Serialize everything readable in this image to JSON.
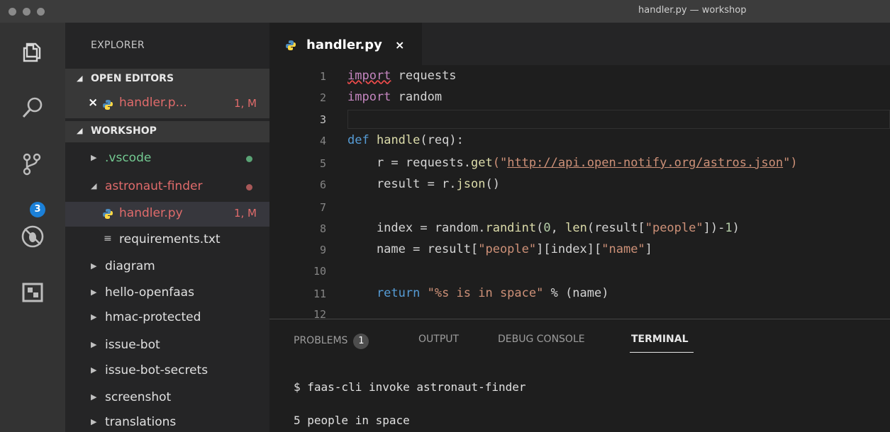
{
  "window": {
    "title": "handler.py — workshop"
  },
  "activity_bar": {
    "icons": [
      "files-icon",
      "search-icon",
      "source-control-icon",
      "debug-icon",
      "extensions-icon"
    ],
    "scm_badge": "3"
  },
  "sidebar": {
    "title": "EXPLORER",
    "open_editors": {
      "header": "OPEN EDITORS",
      "items": [
        {
          "label": "handler.p...",
          "status": "1, M"
        }
      ]
    },
    "workspace": {
      "header": "WORKSHOP",
      "items": [
        {
          "label": ".vscode",
          "type": "folder",
          "expanded": false
        },
        {
          "label": "astronaut-finder",
          "type": "folder",
          "expanded": true
        },
        {
          "label": "handler.py",
          "type": "file",
          "status": "1, M"
        },
        {
          "label": "requirements.txt",
          "type": "file"
        },
        {
          "label": "diagram",
          "type": "folder",
          "expanded": false
        },
        {
          "label": "hello-openfaas",
          "type": "folder",
          "expanded": false
        },
        {
          "label": "hmac-protected",
          "type": "folder",
          "expanded": false
        },
        {
          "label": "issue-bot",
          "type": "folder",
          "expanded": false
        },
        {
          "label": "issue-bot-secrets",
          "type": "folder",
          "expanded": false
        },
        {
          "label": "screenshot",
          "type": "folder",
          "expanded": false
        },
        {
          "label": "translations",
          "type": "folder",
          "expanded": false
        }
      ]
    }
  },
  "editor": {
    "tab": {
      "label": "handler.py",
      "close": "×"
    },
    "line_numbers": [
      "1",
      "2",
      "3",
      "4",
      "5",
      "6",
      "7",
      "8",
      "9",
      "10",
      "11",
      "12"
    ],
    "code": {
      "l1_kw": "import",
      "l1_rest": " requests",
      "l2_kw": "import",
      "l2_rest": " random",
      "l4_kw": "def",
      "l4_fn": "handle",
      "l4_rest": "(req):",
      "l5_a": "    r = requests.",
      "l5_fn": "get",
      "l5_b": "(\"",
      "l5_url": "http://api.open-notify.org/astros.json",
      "l5_c": "\")",
      "l6_a": "    result = r.",
      "l6_fn": "json",
      "l6_b": "()",
      "l8_a": "    index = random.",
      "l8_fn": "randint",
      "l8_b": "(",
      "l8_num": "0",
      "l8_c": ", ",
      "l8_len": "len",
      "l8_d": "(result[",
      "l8_str": "\"people\"",
      "l8_e": "])-",
      "l8_num2": "1",
      "l8_f": ")",
      "l9_a": "    name = result[",
      "l9_s1": "\"people\"",
      "l9_b": "][index][",
      "l9_s2": "\"name\"",
      "l9_c": "]",
      "l11_kw": "    return",
      "l11_str": " \"%s is in space\"",
      "l11_rest": " % (name)"
    }
  },
  "panel": {
    "tabs": [
      "PROBLEMS",
      "OUTPUT",
      "DEBUG CONSOLE",
      "TERMINAL"
    ],
    "problems_count": "1",
    "active_tab": "TERMINAL",
    "terminal_lines": [
      "$ faas-cli invoke astronaut-finder",
      "5 people in space"
    ]
  },
  "colors": {
    "modified": "#e06b6b",
    "untracked": "#73c991",
    "accent": "#1b80d8"
  }
}
